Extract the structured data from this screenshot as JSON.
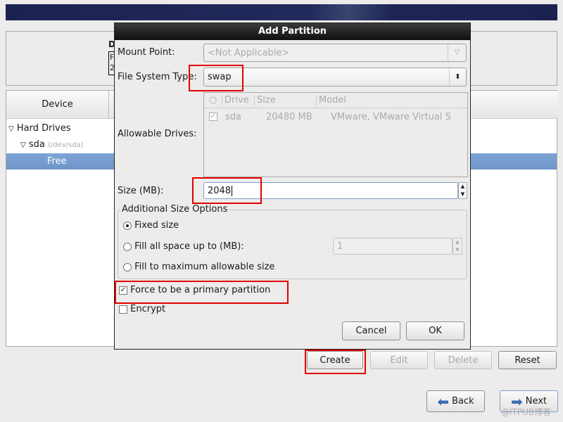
{
  "background": {
    "device_header": "Device",
    "tree": [
      {
        "label": "Hard Drives"
      },
      {
        "label": "sda",
        "sub": "(/dev/sda)"
      },
      {
        "label": "Free"
      }
    ],
    "summary_fragment": [
      "D",
      "F",
      "2"
    ]
  },
  "dialog": {
    "title": "Add Partition",
    "mount_point": {
      "label": "Mount Point:",
      "value": "<Not Applicable>"
    },
    "fs_type": {
      "label": "File System Type:",
      "value": "swap"
    },
    "drives": {
      "label": "Allowable Drives:",
      "columns": [
        "Drive",
        "Size",
        "Model"
      ],
      "rows": [
        {
          "checked": true,
          "drive": "sda",
          "size": "20480 MB",
          "model": "VMware, VMware Virtual S"
        }
      ]
    },
    "size": {
      "label": "Size (MB):",
      "value": "2048"
    },
    "additional": {
      "title": "Additional Size Options",
      "options": [
        {
          "label": "Fixed size",
          "selected": true
        },
        {
          "label": "Fill all space up to (MB):",
          "selected": false,
          "value": "1"
        },
        {
          "label": "Fill to maximum allowable size",
          "selected": false
        }
      ]
    },
    "primary": {
      "label": "Force to be a primary partition",
      "checked": true
    },
    "encrypt": {
      "label": "Encrypt",
      "checked": false
    },
    "cancel": "Cancel",
    "ok": "OK"
  },
  "actions": {
    "create": "Create",
    "edit": "Edit",
    "delete": "Delete",
    "reset": "Reset"
  },
  "nav": {
    "back": "Back",
    "next": "Next"
  },
  "watermark": "@ITPUB博客"
}
